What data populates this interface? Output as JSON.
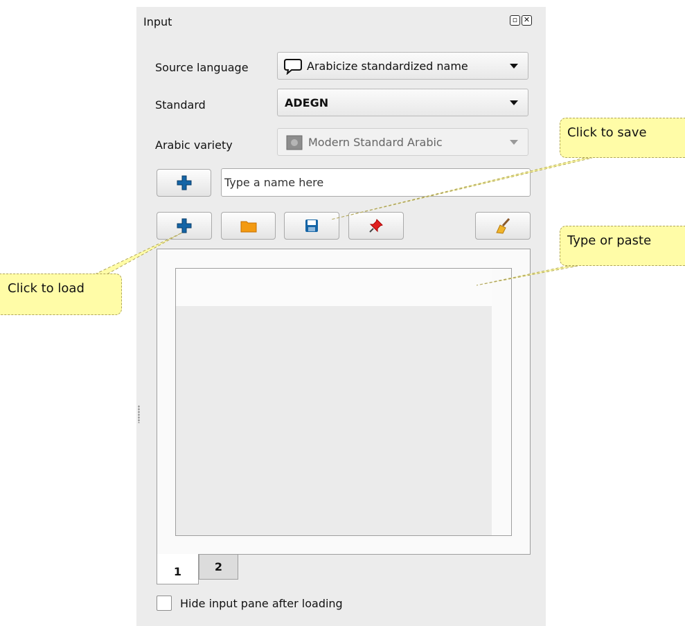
{
  "panel": {
    "title": "Input",
    "float_icon": "float-icon",
    "close_icon": "close-icon"
  },
  "form": {
    "source_language_label": "Source language",
    "source_language_value": "Arabicize standardized name",
    "source_language_icon": "speech-bubble-icon",
    "standard_label": "Standard",
    "standard_value": "ADEGN",
    "variety_label": "Arabic variety",
    "variety_value": "Modern Standard Arabic",
    "variety_icon": "gray-square-icon"
  },
  "name_row": {
    "add_icon": "plus-icon",
    "placeholder": "Type a name here"
  },
  "toolbar": {
    "buttons": [
      "plus-icon",
      "folder-icon",
      "save-icon",
      "pin-icon",
      "broom-icon"
    ]
  },
  "tabs": [
    {
      "label": "1",
      "active": true
    },
    {
      "label": "2",
      "active": false
    }
  ],
  "hide_pane": {
    "label": "Hide input pane after loading",
    "checked": false
  },
  "callouts": {
    "save": "Click to save",
    "paste": "Type or paste",
    "load": "Click to load"
  },
  "colors": {
    "panel_bg": "#ececec",
    "callout_bg": "#fffca7",
    "plus_blue": "#1565a6",
    "folder_orange": "#f39a12"
  }
}
